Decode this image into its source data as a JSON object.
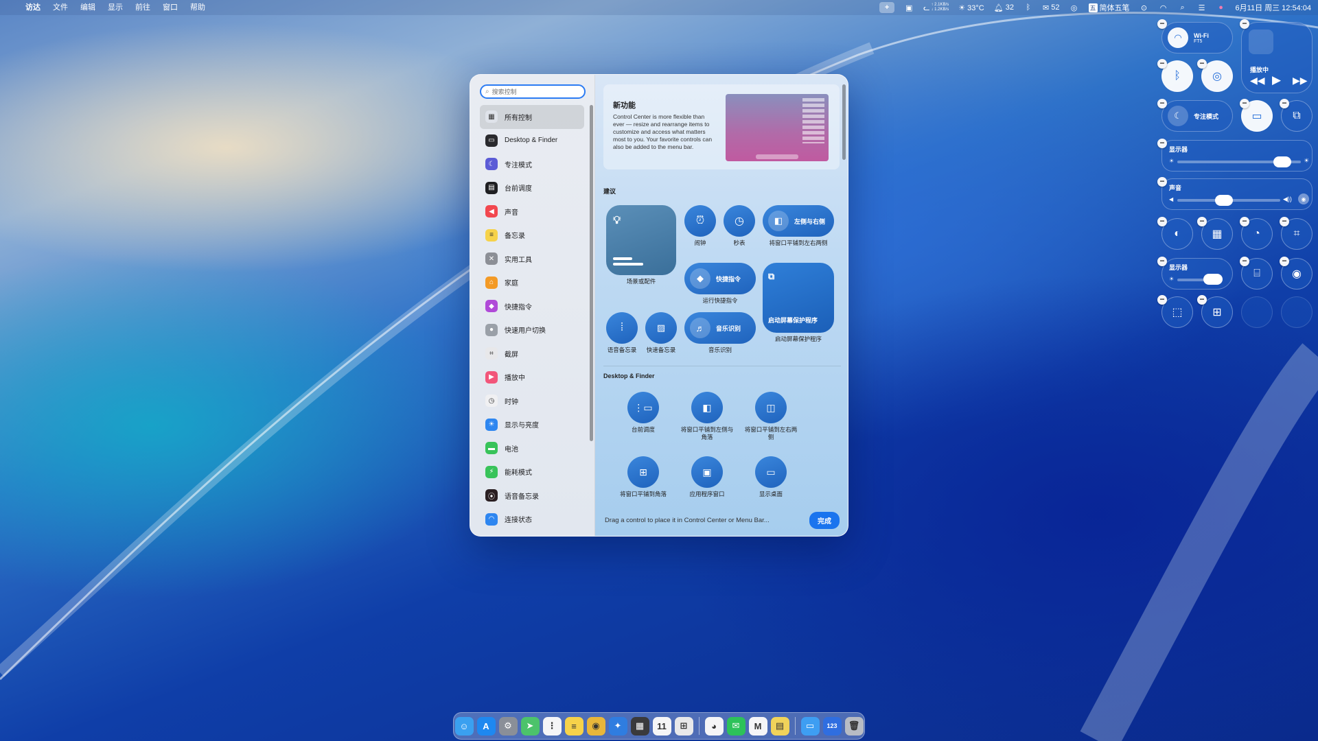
{
  "menubar": {
    "apple": "",
    "items": [
      "访达",
      "文件",
      "编辑",
      "显示",
      "前往",
      "窗口",
      "帮助"
    ],
    "net_up": "↑ 2.1KB/s",
    "net_down": "↓ 1.2KB/s",
    "weather": "☀ 33°C",
    "notif_count": "32",
    "wechat_count": "52",
    "input_method": "简体五笔",
    "datetime": "6月11日 周三 12:54:04"
  },
  "panel": {
    "search_placeholder": "搜索控制",
    "sidebar": [
      {
        "label": "所有控制",
        "icon": "grid-icon",
        "color": "#dfe3ea",
        "glyph": "▦"
      },
      {
        "label": "Desktop & Finder",
        "icon": "desktop-icon",
        "color": "#2a2a2e",
        "glyph": "▭"
      },
      {
        "label": "专注模式",
        "icon": "moon-icon",
        "color": "#5b5bd6",
        "glyph": "☾"
      },
      {
        "label": "台前调度",
        "icon": "stage-manager-icon",
        "color": "#1f1f22",
        "glyph": "▤"
      },
      {
        "label": "声音",
        "icon": "speaker-icon",
        "color": "#f2474f",
        "glyph": "◀"
      },
      {
        "label": "备忘录",
        "icon": "notes-icon",
        "color": "#f6d24a",
        "glyph": "≡"
      },
      {
        "label": "实用工具",
        "icon": "tools-icon",
        "color": "#8c8f96",
        "glyph": "✕"
      },
      {
        "label": "家庭",
        "icon": "home-icon",
        "color": "#f39a26",
        "glyph": "⌂"
      },
      {
        "label": "快捷指令",
        "icon": "shortcuts-icon",
        "color": "#b04ad8",
        "glyph": "◆"
      },
      {
        "label": "快速用户切换",
        "icon": "user-icon",
        "color": "#9aa0a8",
        "glyph": "●"
      },
      {
        "label": "截屏",
        "icon": "screenshot-icon",
        "color": "#e8e8ea",
        "glyph": "⌗"
      },
      {
        "label": "播放中",
        "icon": "play-icon",
        "color": "#f2567a",
        "glyph": "▶"
      },
      {
        "label": "时钟",
        "icon": "clock-icon",
        "color": "#f0f0f2",
        "glyph": "◷"
      },
      {
        "label": "显示与亮度",
        "icon": "brightness-icon",
        "color": "#2e86f0",
        "glyph": "☀"
      },
      {
        "label": "电池",
        "icon": "battery-icon",
        "color": "#38c35a",
        "glyph": "▬"
      },
      {
        "label": "能耗模式",
        "icon": "energy-icon",
        "color": "#38c35a",
        "glyph": "⚡"
      },
      {
        "label": "语音备忘录",
        "icon": "voice-memo-icon",
        "color": "#2a1f22",
        "glyph": "⦿"
      },
      {
        "label": "连接状态",
        "icon": "wifi-icon",
        "color": "#2e86f0",
        "glyph": "◠"
      }
    ],
    "news": {
      "title": "新功能",
      "body": "Control Center is more flexible than ever — resize and rearrange items to customize and access what matters most to you. Your favorite controls can also be added to the menu bar."
    },
    "suggest_title": "建议",
    "suggest": {
      "scene": "场景或配件",
      "alarm": "闹钟",
      "stopwatch": "秒表",
      "tile_lr_label": "左侧与右侧",
      "tile_lr_caption": "将窗口平铺到左右两侧",
      "shortcut_label": "快捷指令",
      "shortcut_caption": "运行快捷指令",
      "voice": "语音备忘录",
      "quicknote": "快速备忘录",
      "music_label": "音乐识别",
      "music_caption": "音乐识别",
      "saver_label": "启动屏幕保护程序",
      "saver_caption": "启动屏幕保护程序"
    },
    "df_title": "Desktop & Finder",
    "df": [
      {
        "caption": "台前调度",
        "icon": "stage-manager-icon",
        "glyph": "⋮▭"
      },
      {
        "caption": "将窗口平铺到左侧与角落",
        "icon": "tile-left-corner-icon",
        "glyph": "◧"
      },
      {
        "caption": "将窗口平铺到左右两侧",
        "icon": "tile-left-right-icon",
        "glyph": "◫"
      },
      {
        "caption": "将窗口平铺到角落",
        "icon": "tile-corners-icon",
        "glyph": "⊞"
      },
      {
        "caption": "应用程序窗口",
        "icon": "app-windows-icon",
        "glyph": "▣"
      },
      {
        "caption": "显示桌面",
        "icon": "show-desktop-icon",
        "glyph": "▭"
      }
    ],
    "footer_text": "Drag a control to place it in Control Center or Menu Bar...",
    "done_label": "完成"
  },
  "cc": {
    "wifi_label": "Wi-Fi",
    "wifi_network": "FT5",
    "nowplaying": "播放中",
    "focus": "专注模式",
    "display": "显示器",
    "sound": "声音",
    "display2": "显示器",
    "display_level": 0.85,
    "sound_level": 0.45
  },
  "dock": [
    {
      "name": "finder-icon",
      "color": "#3aa0f0",
      "g": "☺"
    },
    {
      "name": "app-store-icon",
      "color": "#1e88f0",
      "g": "A"
    },
    {
      "name": "system-settings-icon",
      "color": "#8a8f98",
      "g": "⚙"
    },
    {
      "name": "maps-icon",
      "color": "#4cc36b",
      "g": "➤"
    },
    {
      "name": "reminders-icon",
      "color": "#f5f5f7",
      "g": "⋮"
    },
    {
      "name": "notes-icon",
      "color": "#f6d24a",
      "g": "≡"
    },
    {
      "name": "chrome-icon",
      "color": "#e8b63a",
      "g": "◉"
    },
    {
      "name": "safari-icon",
      "color": "#2f7de0",
      "g": "✦"
    },
    {
      "name": "calculator-icon",
      "color": "#3a3a3c",
      "g": "▦"
    },
    {
      "name": "calendar-icon",
      "color": "#f5f5f7",
      "g": "11"
    },
    {
      "name": "launchpad-icon",
      "color": "#e8e8ea",
      "g": "⊞"
    },
    {
      "name": "qq-icon",
      "color": "#f5f5f7",
      "g": "◕"
    },
    {
      "name": "wechat-icon",
      "color": "#2dc25a",
      "g": "✉"
    },
    {
      "name": "gmail-icon",
      "color": "#f5f5f7",
      "g": "M"
    },
    {
      "name": "stickies-icon",
      "color": "#f0d35a",
      "g": "▤"
    },
    {
      "name": "downloads-folder-icon",
      "color": "#3e9ef2",
      "g": "▭"
    },
    {
      "name": "numbers-icon",
      "color": "#2f6ee0",
      "g": "123"
    },
    {
      "name": "trash-icon",
      "color": "#b8bcc4",
      "g": "🗑"
    }
  ]
}
